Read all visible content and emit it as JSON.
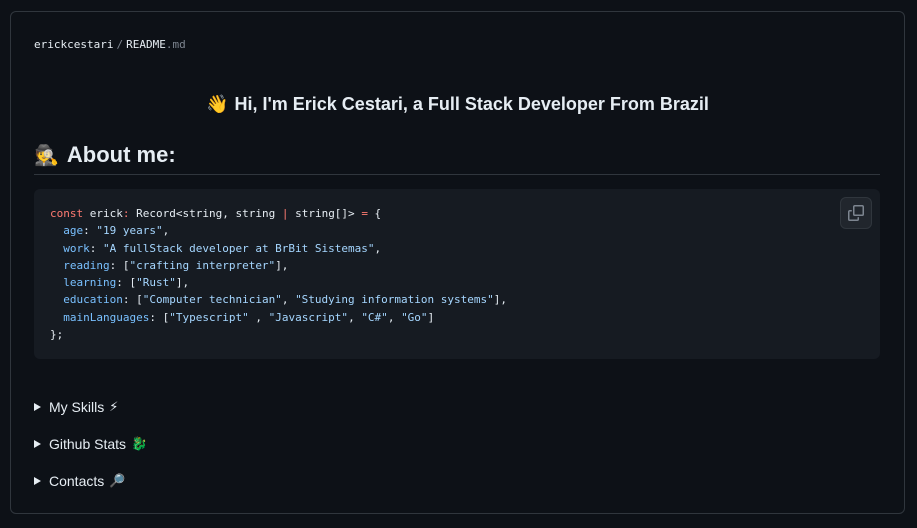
{
  "breadcrumb": {
    "owner": "erickcestari",
    "separator": "/",
    "file_name": "README",
    "file_ext": ".md"
  },
  "greeting": {
    "emoji": "👋",
    "text": "Hi, I'm Erick Cestari, a Full Stack Developer From Brazil"
  },
  "about": {
    "emoji": "🕵️",
    "title": "About me:"
  },
  "code": {
    "line1": {
      "kw": "const",
      "name": " erick",
      "colon": ": ",
      "type1": "Record<string, string ",
      "pipe": "|",
      "type2": " string[]> ",
      "eq": "=",
      "brace": " {"
    },
    "fields": [
      {
        "key": "age",
        "value": "\"19 years\"",
        "tail": ","
      },
      {
        "key": "work",
        "value": "\"A fullStack developer at BrBit Sistemas\"",
        "tail": ","
      },
      {
        "key": "reading",
        "value": "\"crafting interpreter\"",
        "tail": "],"
      },
      {
        "key": "learning",
        "value": "\"Rust\"",
        "tail": "],"
      },
      {
        "key": "education",
        "value": "\"Computer technician\"",
        "value2": "\"Studying information systems\"",
        "tail": "],"
      },
      {
        "key": "mainLanguages",
        "value": "\"Typescript\"",
        "value2": "\"Javascript\"",
        "value3": "\"C#\"",
        "value4": "\"Go\"",
        "tail": "]"
      }
    ],
    "close": "};"
  },
  "copy_button": {
    "icon": "copy-icon"
  },
  "sections": [
    {
      "label": "My Skills",
      "emoji": "⚡"
    },
    {
      "label": "Github Stats",
      "emoji": "🐉"
    },
    {
      "label": "Contacts",
      "emoji": "🔎"
    }
  ],
  "colors": {
    "background": "#0d1117",
    "code_background": "#161b22",
    "border": "#30363d",
    "keyword": "#ff7b72",
    "property": "#79c0ff",
    "string": "#a5d6ff"
  }
}
